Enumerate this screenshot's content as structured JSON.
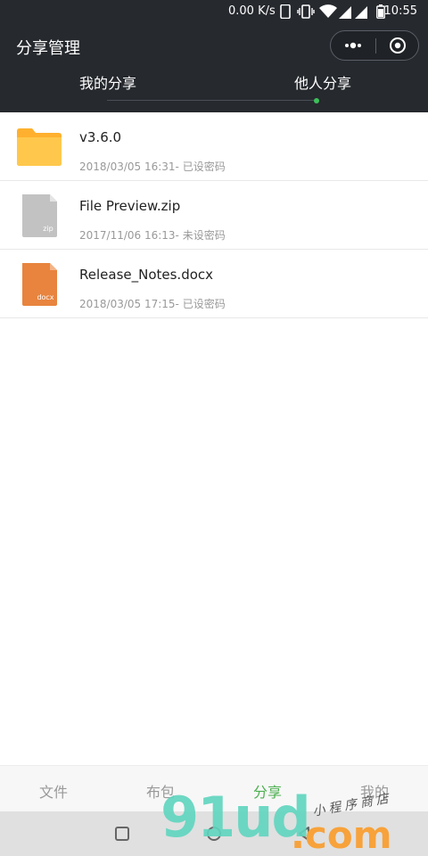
{
  "status_bar": {
    "net_speed": "0.00 K/s",
    "time": "10:55"
  },
  "header": {
    "title": "分享管理",
    "tabs": [
      {
        "label": "我的分享",
        "active": false
      },
      {
        "label": "他人分享",
        "active": true
      }
    ]
  },
  "files": [
    {
      "name": "v3.6.0",
      "meta": "2018/03/05 16:31- 已设密码",
      "icon": "folder-icon",
      "type_label": ""
    },
    {
      "name": "File Preview.zip",
      "meta": "2017/11/06 16:13- 未设密码",
      "icon": "zip-file-icon",
      "type_label": "zip"
    },
    {
      "name": "Release_Notes.docx",
      "meta": "2018/03/05 17:15- 已设密码",
      "icon": "docx-file-icon",
      "type_label": "docx"
    }
  ],
  "tabbar": {
    "items": [
      {
        "label": "文件",
        "active": false
      },
      {
        "label": "布包",
        "active": false
      },
      {
        "label": "分享",
        "active": true
      },
      {
        "label": "我的",
        "active": false
      }
    ]
  },
  "watermark": {
    "logo": "91ud",
    "tld": ".com",
    "tagline": "小程序商店"
  },
  "colors": {
    "header_bg": "#26292e",
    "accent": "#4caf50",
    "folder": "#ffc24a",
    "zip": "#bdbdbd",
    "docx": "#e8843e"
  }
}
